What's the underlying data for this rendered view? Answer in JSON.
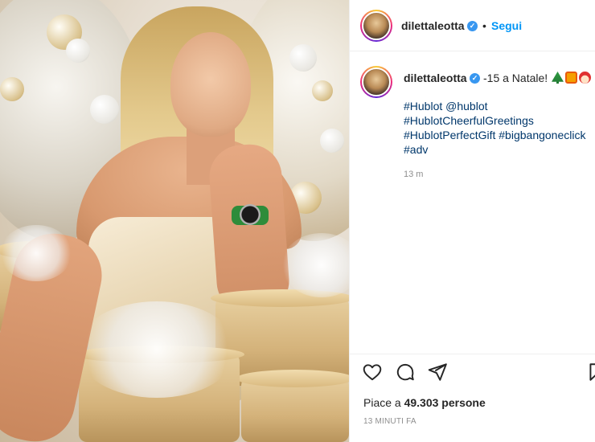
{
  "header": {
    "username": "dilettaleotta",
    "verified_badge": "✓",
    "separator": "•",
    "follow_label": "Segui"
  },
  "caption": {
    "username": "dilettaleotta",
    "verified_badge": "✓",
    "text": "-15 a Natale!",
    "emojis": [
      "christmas-tree",
      "gift",
      "santa"
    ],
    "line1": "#Hublot @hublot",
    "line2": "#HublotCheerfulGreetings",
    "line3": "#HublotPerfectGift #bigbangoneclick",
    "line4": "#adv",
    "time": "13 m"
  },
  "actions": {
    "icons": [
      "heart-icon",
      "comment-icon",
      "share-icon",
      "bookmark-icon"
    ]
  },
  "likes": {
    "prefix": "Piace a ",
    "count": "49.303",
    "suffix": " persone"
  },
  "timestamp": "13 MINUTI FA",
  "colors": {
    "link": "#00376b",
    "follow": "#0095f6",
    "verified": "#3897f0",
    "muted": "#8e8e8e"
  }
}
